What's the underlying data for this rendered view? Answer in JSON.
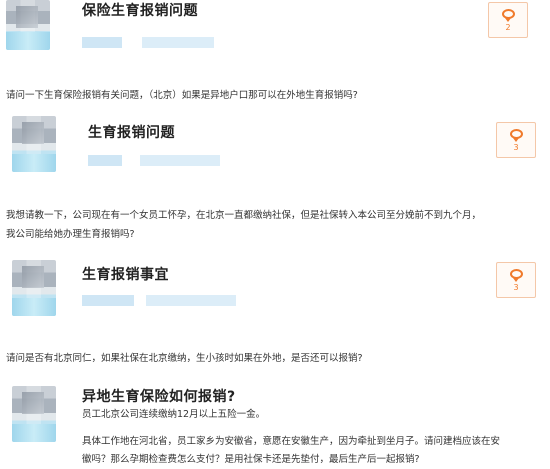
{
  "posts": [
    {
      "title": "保险生育报销问题",
      "comment_count": "2",
      "question": "请问一下生育保险报销有关问题，（北京）如果是异地户口那可以在外地生育报销吗?"
    },
    {
      "title": "生育报销问题",
      "comment_count": "3",
      "question_line1": "我想请教一下，公司现在有一个女员工怀孕，在北京一直都缴纳社保，但是社保转入本公司至分娩前不到九个月，",
      "question_line2": "我公司能给她办理生育报销吗?"
    },
    {
      "title": "生育报销事宜",
      "comment_count": "3",
      "question": "请问是否有北京同仁，如果社保在北京缴纳，生小孩时如果在外地，是否还可以报销?"
    },
    {
      "title": "异地生育保险如何报销?",
      "subtitle": "员工北京公司连续缴纳12月以上五险一金。",
      "body_line1": "具体工作地在河北省，员工家乡为安徽省，意愿在安徽生产，因为牵扯到坐月子。请问建档应该在安",
      "body_line2": "徽吗？那么孕期检查费怎么支付？是用社保卡还是先垫付，最后生产后一起报销?"
    }
  ]
}
